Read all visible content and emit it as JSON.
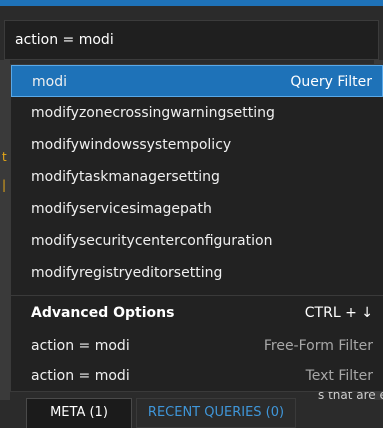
{
  "search": {
    "value": "action = modi"
  },
  "suggestions": [
    {
      "label": "modi",
      "tag": "Query Filter"
    },
    {
      "label": "modifyzonecrossingwarningsetting"
    },
    {
      "label": "modifywindowssystempolicy"
    },
    {
      "label": "modifytaskmanagersetting"
    },
    {
      "label": "modifyservicesimagepath"
    },
    {
      "label": "modifysecuritycenterconfiguration"
    },
    {
      "label": "modifyregistryeditorsetting"
    }
  ],
  "advanced": {
    "title": "Advanced Options",
    "shortcut": "CTRL + ↓",
    "options": [
      {
        "label": "action = modi",
        "tag": "Free-Form Filter"
      },
      {
        "label": "action = modi",
        "tag": "Text Filter"
      }
    ]
  },
  "tabs": {
    "meta": "META (1)",
    "recent": "RECENT QUERIES (0)"
  },
  "background": {
    "snippet": "s that are e"
  },
  "colors": {
    "selected": "#1e72b8",
    "panel": "#222222",
    "accent_text": "#3f96d9"
  }
}
